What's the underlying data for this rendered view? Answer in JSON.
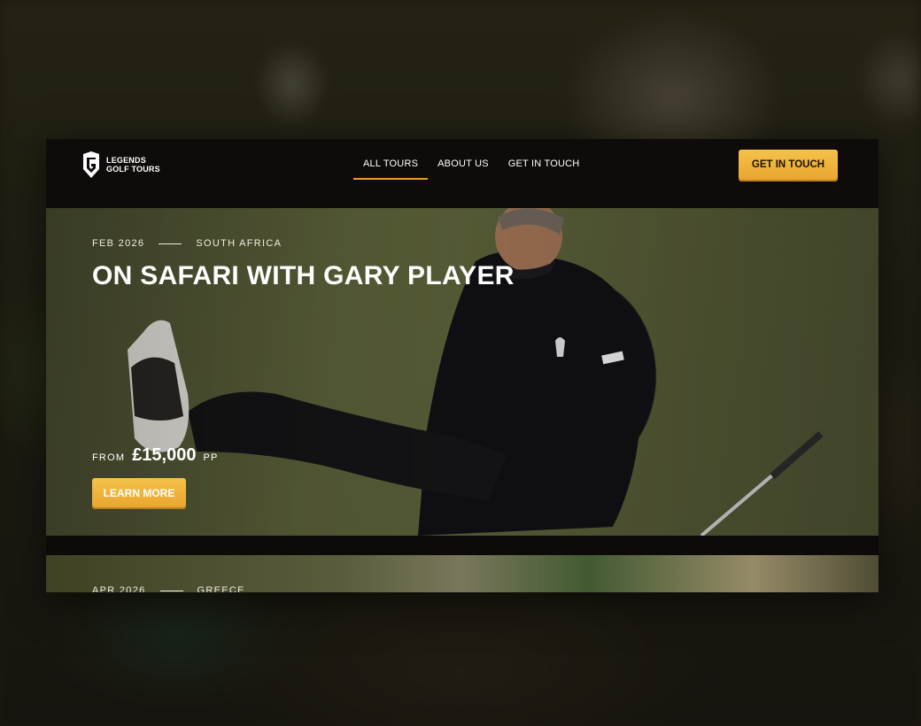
{
  "brand": {
    "line1": "LEGENDS",
    "line2": "GOLF TOURS"
  },
  "nav": {
    "items": [
      {
        "label": "ALL TOURS",
        "active": true
      },
      {
        "label": "ABOUT US",
        "active": false
      },
      {
        "label": "GET IN TOUCH",
        "active": false
      }
    ],
    "cta_label": "GET IN TOUCH"
  },
  "tours": [
    {
      "date": "FEB 2026",
      "location": "SOUTH AFRICA",
      "title": "ON SAFARI WITH GARY PLAYER",
      "price_prefix": "FROM",
      "price": "£15,000",
      "price_suffix": "PP",
      "button_label": "LEARN MORE"
    },
    {
      "date": "APR 2026",
      "location": "GREECE"
    }
  ],
  "colors": {
    "accent": "#e9a630",
    "nav_bg": "#0e0b0a"
  }
}
